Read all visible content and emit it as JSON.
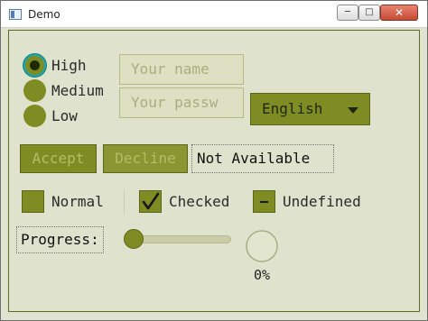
{
  "window": {
    "title": "Demo",
    "minimize_icon": "minimize-icon",
    "maximize_icon": "maximize-icon",
    "close_icon": "close-icon"
  },
  "priority": {
    "options": [
      "High",
      "Medium",
      "Low"
    ],
    "selected": "High"
  },
  "form": {
    "name_placeholder": "Your name",
    "password_placeholder": "Your passw"
  },
  "language": {
    "selected": "English"
  },
  "buttons": {
    "accept": "Accept",
    "decline": "Decline",
    "not_available": "Not Available"
  },
  "checkboxes": [
    {
      "label": "Normal",
      "state": "unchecked"
    },
    {
      "label": "Checked",
      "state": "checked"
    },
    {
      "label": "Undefined",
      "state": "indeterminate"
    }
  ],
  "progress": {
    "label": "Progress:",
    "slider_value": 0,
    "percent_text": "0%",
    "fraction": 0.0
  },
  "colors": {
    "accent": "#7f8c23",
    "background": "#dfe3cd",
    "focus_ring": "#24a4a4"
  }
}
